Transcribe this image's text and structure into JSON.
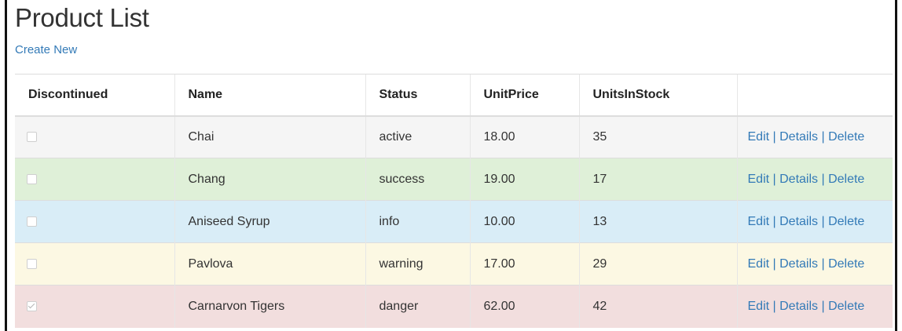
{
  "page": {
    "title": "Product List",
    "create_link": "Create New"
  },
  "table": {
    "headers": [
      "Discontinued",
      "Name",
      "Status",
      "UnitPrice",
      "UnitsInStock",
      ""
    ],
    "actions": {
      "edit": "Edit",
      "details": "Details",
      "delete": "Delete",
      "separator": " | "
    },
    "rows": [
      {
        "discontinued": false,
        "name": "Chai",
        "status": "active",
        "unit_price": "18.00",
        "units_in_stock": "35",
        "bg": "#f5f5f5"
      },
      {
        "discontinued": false,
        "name": "Chang",
        "status": "success",
        "unit_price": "19.00",
        "units_in_stock": "17",
        "bg": "#dff0d8"
      },
      {
        "discontinued": false,
        "name": "Aniseed Syrup",
        "status": "info",
        "unit_price": "10.00",
        "units_in_stock": "13",
        "bg": "#d9edf7"
      },
      {
        "discontinued": false,
        "name": "Pavlova",
        "status": "warning",
        "unit_price": "17.00",
        "units_in_stock": "29",
        "bg": "#fcf8e3"
      },
      {
        "discontinued": true,
        "name": "Carnarvon Tigers",
        "status": "danger",
        "unit_price": "62.00",
        "units_in_stock": "42",
        "bg": "#f2dede"
      }
    ]
  },
  "colors": {
    "link": "#337ab7"
  }
}
